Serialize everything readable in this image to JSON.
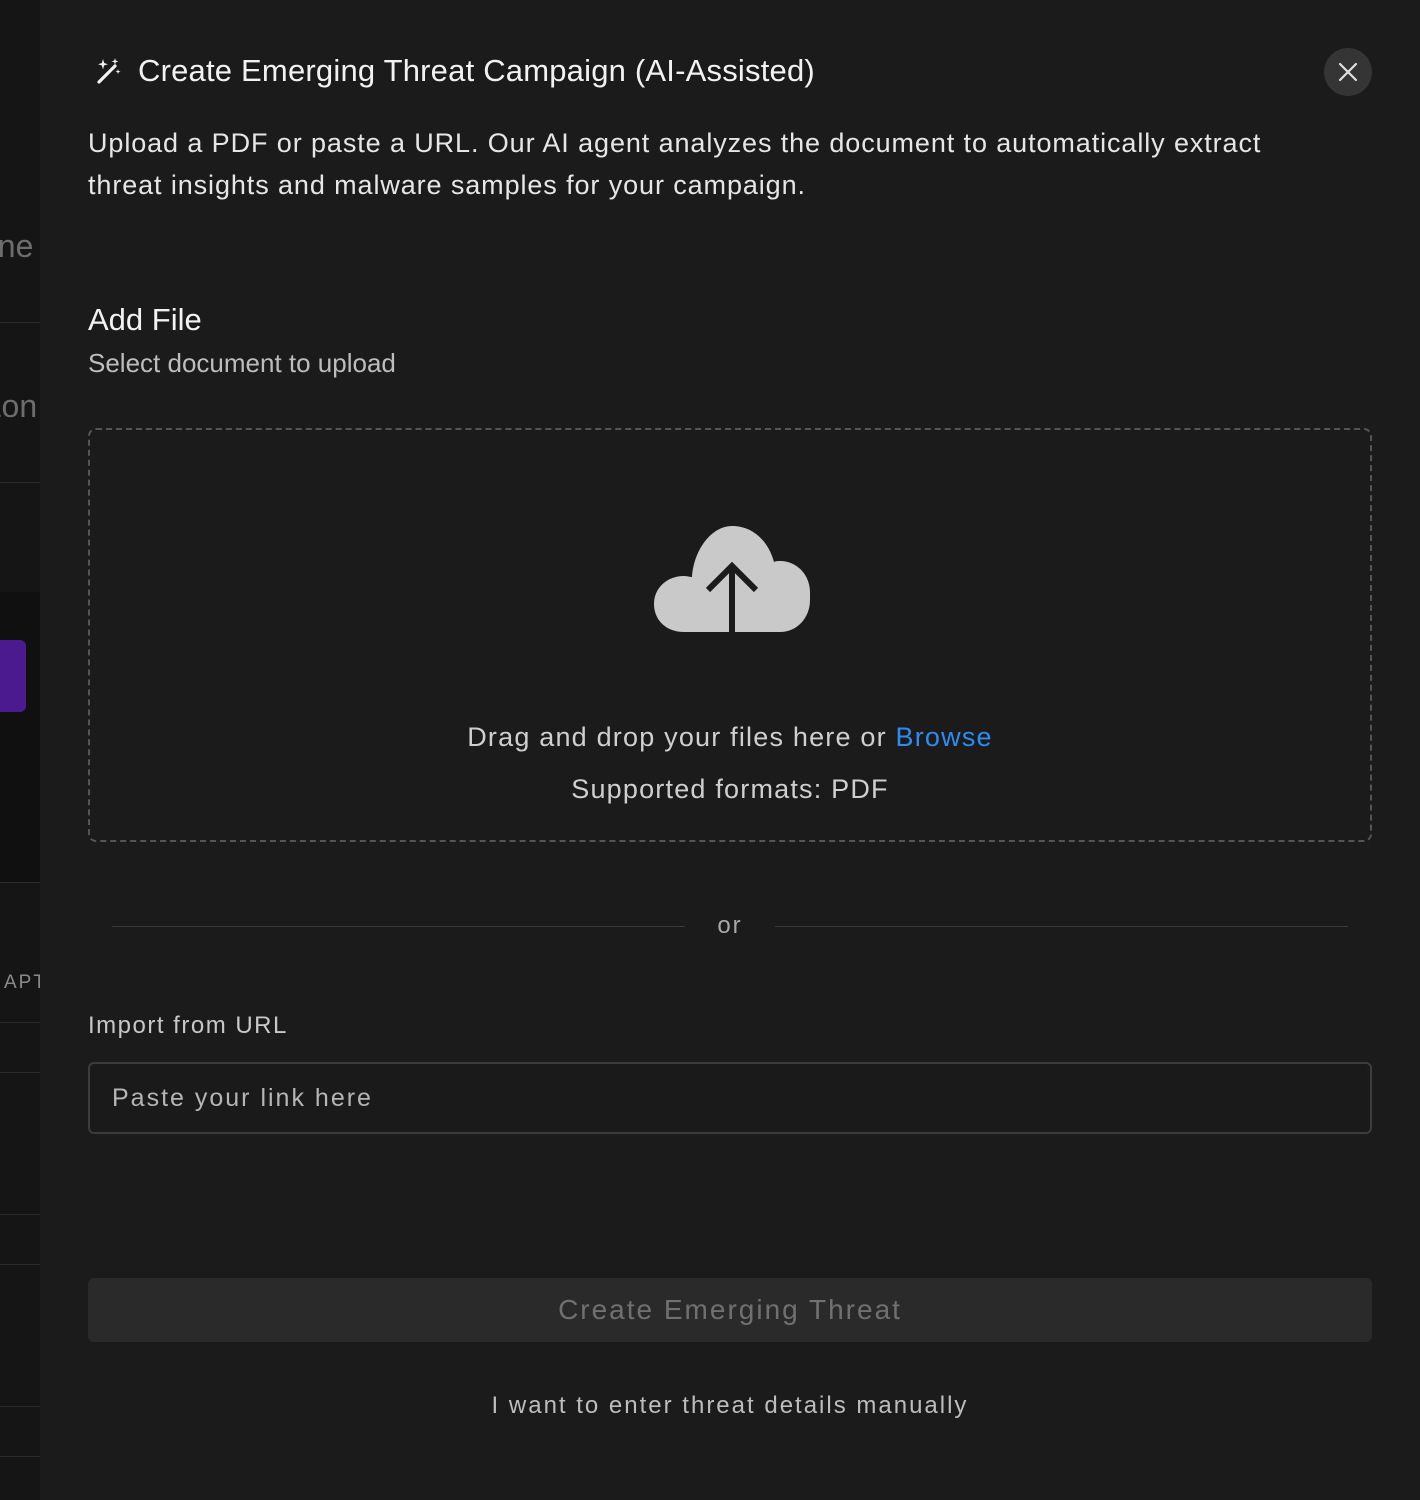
{
  "background": {
    "fragment_1": "one",
    "fragment_2": "Zon",
    "fragment_3": "APT"
  },
  "modal": {
    "title": "Create Emerging Threat Campaign (AI-Assisted)",
    "description": "Upload a PDF or paste a URL. Our AI agent analyzes the document to automatically extract threat insights and malware samples for your campaign.",
    "close_icon": "close-icon",
    "title_icon": "sparkle-magic-icon"
  },
  "upload": {
    "section_title": "Add File",
    "section_subtitle": "Select document to upload",
    "drop_text": "Drag and drop your files here or",
    "browse_label": "Browse",
    "formats_text": "Supported formats: PDF",
    "icon": "cloud-upload-icon"
  },
  "divider": {
    "text": "or"
  },
  "url_import": {
    "label": "Import from URL",
    "placeholder": "Paste your link here",
    "value": ""
  },
  "actions": {
    "create_label": "Create Emerging Threat",
    "manual_label": "I want to enter threat details manually"
  },
  "colors": {
    "modal_bg": "#1b1b1c",
    "accent_link": "#2d8cf0",
    "disabled_button_bg": "#2a2a2b",
    "disabled_button_text": "#707070",
    "background_purple": "#4b1a8f"
  }
}
